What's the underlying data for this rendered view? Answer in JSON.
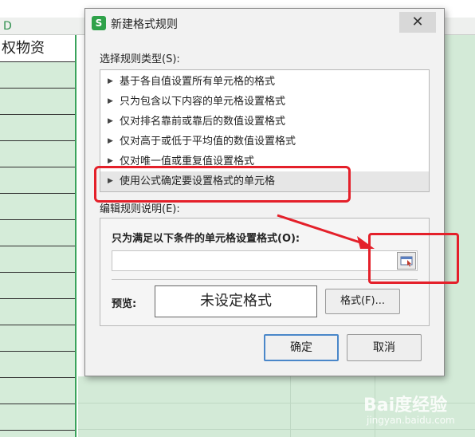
{
  "sheet": {
    "column_letter": "D",
    "header_cell": "权物资"
  },
  "dialog": {
    "title": "新建格式规则",
    "app_icon": "S",
    "close_glyph": "✕",
    "select_rule_type_label": "选择规则类型(S):",
    "rule_types": [
      "基于各自值设置所有单元格的格式",
      "只为包含以下内容的单元格设置格式",
      "仅对排名靠前或靠后的数值设置格式",
      "仅对高于或低于平均值的数值设置格式",
      "仅对唯一值或重复值设置格式",
      "使用公式确定要设置格式的单元格"
    ],
    "selected_rule_index": 5,
    "edit_rule_label": "编辑规则说明(E):",
    "condition_label": "只为满足以下条件的单元格设置格式(O):",
    "formula_value": "",
    "preview_label": "预览:",
    "preview_text": "未设定格式",
    "format_button": "格式(F)...",
    "ok_button": "确定",
    "cancel_button": "取消"
  },
  "watermark": {
    "brand": "Bai度经验",
    "sub": "jingyan.baidu.com"
  },
  "colors": {
    "annotation_red": "#e4202a",
    "selection_green": "#3aa35c",
    "app_icon_green": "#2fa24a"
  },
  "icons": [
    "app-logo-icon",
    "close-icon",
    "expand-triangle-icon",
    "range-select-icon",
    "annotation-arrow"
  ]
}
